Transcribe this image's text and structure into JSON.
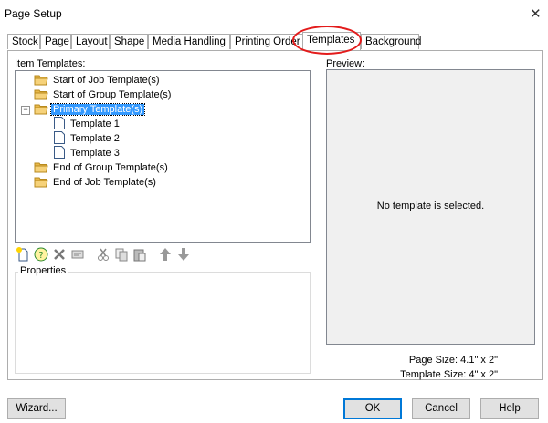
{
  "window": {
    "title": "Page Setup",
    "close_glyph": "✕"
  },
  "tabs": [
    {
      "label": "Stock"
    },
    {
      "label": "Page"
    },
    {
      "label": "Layout"
    },
    {
      "label": "Shape"
    },
    {
      "label": "Media Handling"
    },
    {
      "label": "Printing Order"
    },
    {
      "label": "Templates",
      "active": true
    },
    {
      "label": "Background"
    }
  ],
  "item_templates": {
    "label": "Item Templates:",
    "nodes": [
      {
        "label": "Start of Job Template(s)",
        "icon": "folder-icon"
      },
      {
        "label": "Start of Group Template(s)",
        "icon": "folder-icon"
      },
      {
        "label": "Primary Template(s)",
        "icon": "folder-icon",
        "selected": true,
        "expanded": true
      },
      {
        "label": "Template 1",
        "icon": "document-icon"
      },
      {
        "label": "Template 2",
        "icon": "document-icon"
      },
      {
        "label": "Template 3",
        "icon": "document-icon"
      },
      {
        "label": "End of Group Template(s)",
        "icon": "folder-icon"
      },
      {
        "label": "End of Job Template(s)",
        "icon": "folder-icon"
      }
    ],
    "expander_glyph": "−"
  },
  "toolbar": {
    "icons": [
      "new-template-icon",
      "help-template-icon",
      "delete-icon",
      "properties-icon",
      "cut-icon",
      "copy-icon",
      "paste-icon",
      "move-up-icon",
      "move-down-icon"
    ]
  },
  "properties": {
    "label": "Properties"
  },
  "preview": {
    "label": "Preview:",
    "message": "No template is selected.",
    "page_size": "Page Size:  4.1\" x 2\"",
    "template_size": "Template Size:  4\" x 2\""
  },
  "buttons": {
    "wizard": "Wizard...",
    "ok": "OK",
    "cancel": "Cancel",
    "help": "Help"
  },
  "colors": {
    "selection": "#3399ff",
    "highlight_ellipse": "#e31b1b",
    "default_button_border": "#0078d7"
  }
}
